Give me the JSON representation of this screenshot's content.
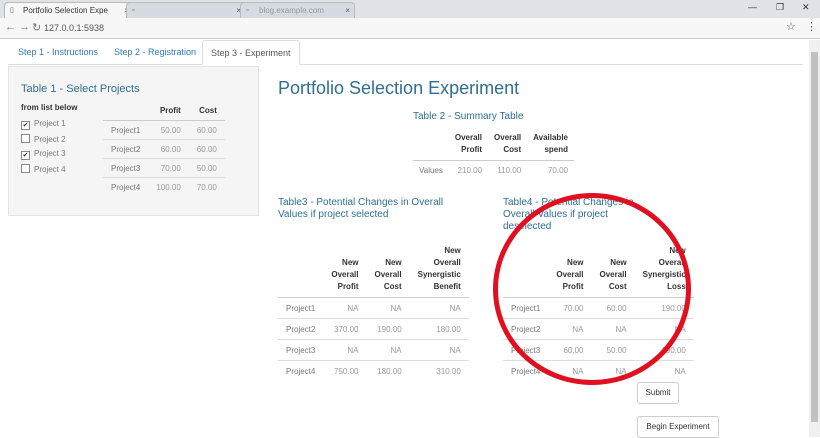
{
  "browser": {
    "tabs": [
      {
        "label": "Portfolio Selection Expe"
      },
      {
        "label": ""
      },
      {
        "label": "blog.example.com"
      }
    ],
    "url": "127.0.0.1:5938"
  },
  "page_tabs": [
    {
      "label": "Step 1 - Instructions"
    },
    {
      "label": "Step 2 - Registration"
    },
    {
      "label": "Step 3 - Experiment"
    }
  ],
  "table1": {
    "title": "Table 1 - Select Projects",
    "list_label": "from list below",
    "checkboxes": [
      {
        "label": "Project 1",
        "checked": "✔"
      },
      {
        "label": "Project 2",
        "checked": ""
      },
      {
        "label": "Project 3",
        "checked": "✔"
      },
      {
        "label": "Project 4",
        "checked": ""
      }
    ],
    "headers": [
      "",
      "Profit",
      "Cost"
    ],
    "rows": [
      [
        "Project1",
        "50.00",
        "60.00"
      ],
      [
        "Project2",
        "60.00",
        "60.00"
      ],
      [
        "Project3",
        "70.00",
        "50.00"
      ],
      [
        "Project4",
        "100.00",
        "70.00"
      ]
    ]
  },
  "main": {
    "title": "Portfolio Selection Experiment",
    "table2": {
      "title": "Table 2 - Summary Table",
      "headers": [
        "",
        "Overall\nProfit",
        "Overall\nCost",
        "Available\nspend"
      ],
      "row": [
        "Values",
        "210.00",
        "110.00",
        "70.00"
      ]
    },
    "table3": {
      "title": "Table3 - Potential Changes in Overall Values if project selected",
      "headers": [
        "",
        "New\nOverall\nProfit",
        "New\nOverall\nCost",
        "New\nOverall\nSynergistic\nBenefit"
      ],
      "rows": [
        [
          "Project1",
          "NA",
          "NA",
          "NA"
        ],
        [
          "Project2",
          "370.00",
          "190.00",
          "180.00"
        ],
        [
          "Project3",
          "NA",
          "NA",
          "NA"
        ],
        [
          "Project4",
          "750.00",
          "180.00",
          "310.00"
        ]
      ]
    },
    "table4": {
      "title": "Table4 - Potential Changes in Overall Values if project deselected",
      "headers": [
        "",
        "New\nOverall\nProfit",
        "New\nOverall\nCost",
        "New\nOverall\nSynergistic\nLoss"
      ],
      "rows": [
        [
          "Project1",
          "70.00",
          "60.00",
          "190.00"
        ],
        [
          "Project2",
          "NA",
          "NA",
          "NA"
        ],
        [
          "Project3",
          "60.00",
          "50.00",
          "190.00"
        ],
        [
          "Project4",
          "NA",
          "NA",
          "NA"
        ]
      ]
    },
    "submit_label": "Submit",
    "begin_label": "Begin Experiment"
  },
  "colors": {
    "heading": "#2f6f8f",
    "annotation": "#e01020",
    "link": "#337ab7"
  }
}
